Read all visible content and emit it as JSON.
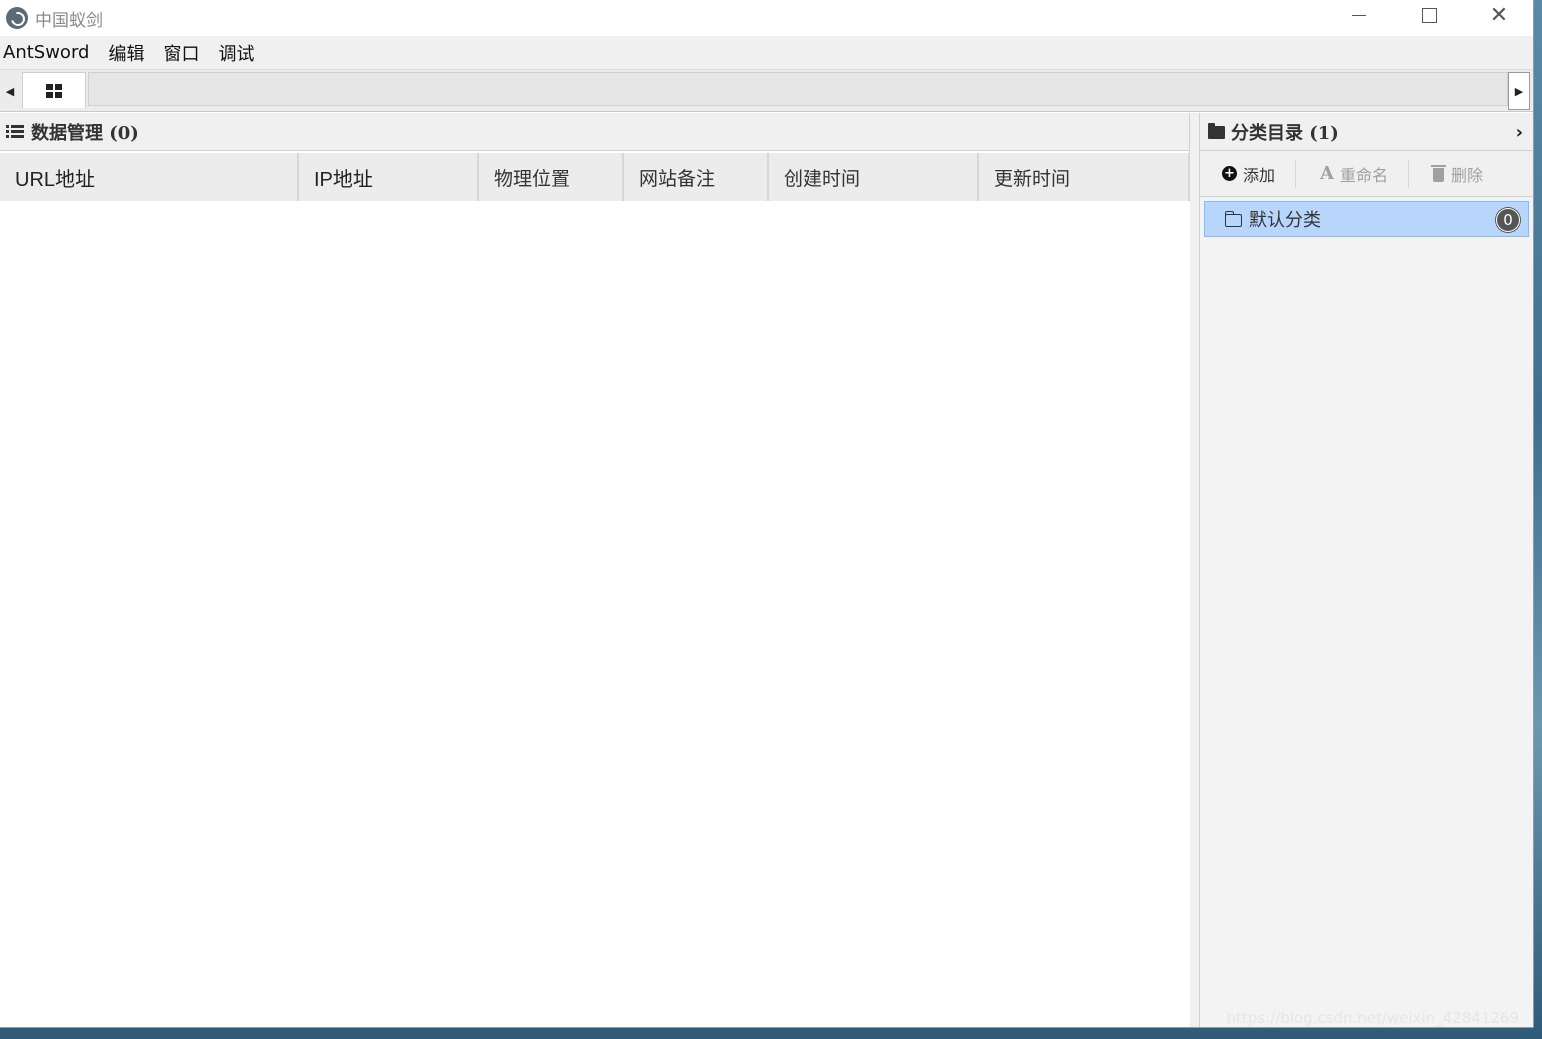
{
  "window": {
    "title": "中国蚁剑"
  },
  "menu": {
    "items": [
      "AntSword",
      "编辑",
      "窗口",
      "调试"
    ]
  },
  "data_panel": {
    "title": "数据管理 (0)",
    "columns": [
      "URL地址",
      "IP地址",
      "物理位置",
      "网站备注",
      "创建时间",
      "更新时间"
    ],
    "rows": []
  },
  "category_panel": {
    "title": "分类目录 (1)",
    "toolbar": {
      "add_label": "添加",
      "rename_label": "重命名",
      "delete_label": "删除"
    },
    "items": [
      {
        "label": "默认分类",
        "count": "0",
        "selected": true
      }
    ]
  },
  "icons": {
    "app_logo": "antsword-logo-icon",
    "home_tab": "grid-icon",
    "data_header": "list-icon",
    "category_header": "folder-icon",
    "add": "plus-circle-icon",
    "rename": "font-icon",
    "delete": "trash-icon",
    "category_item": "folder-outline-icon"
  },
  "colors": {
    "selected_row": "#b8d6fb",
    "badge": "#555555",
    "panel_bg": "#f0f0f0"
  },
  "watermark": "https://blog.csdn.net/weixin_42841269"
}
